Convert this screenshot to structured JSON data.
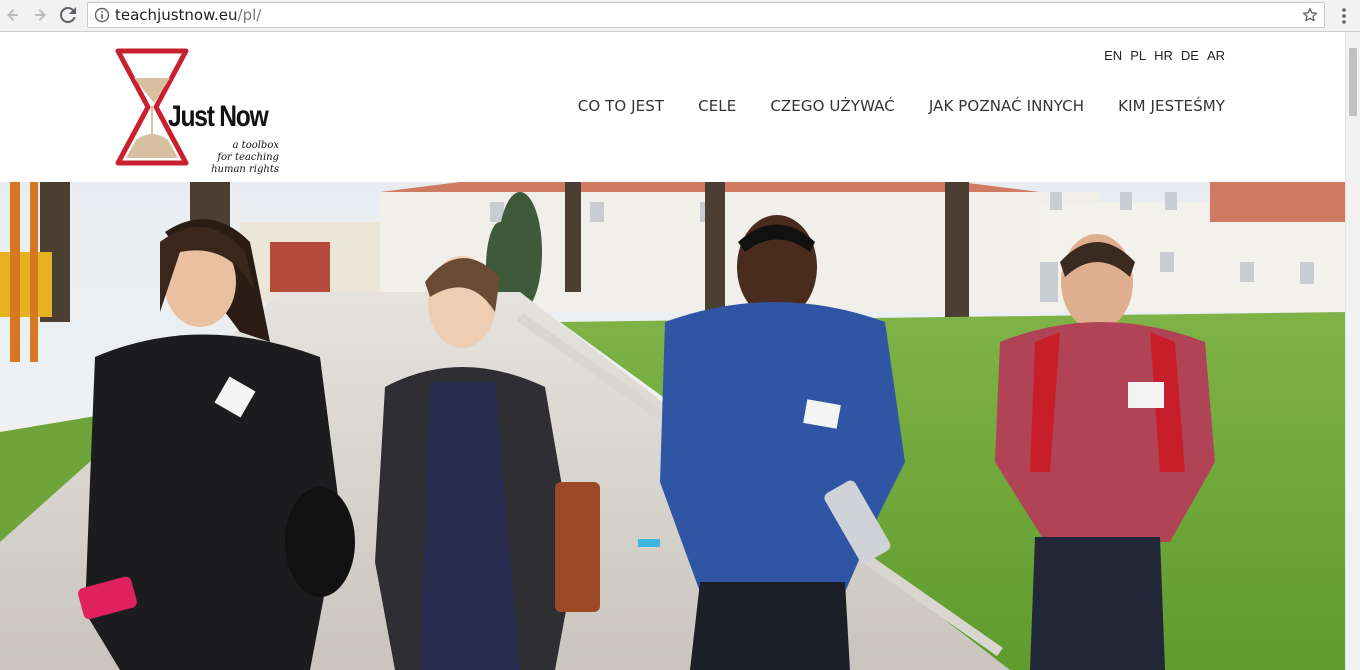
{
  "browser": {
    "url_domain": "teachjustnow.eu",
    "url_path": "/pl/"
  },
  "logo": {
    "brand": "Just Now",
    "tagline": [
      "a toolbox",
      "for teaching",
      "human rights"
    ]
  },
  "languages": [
    "EN",
    "PL",
    "HR",
    "DE",
    "AR"
  ],
  "nav": [
    "CO TO JEST",
    "CELE",
    "CZEGO UŻYWAĆ",
    "JAK POZNAĆ INNYCH",
    "KIM JESTEŚMY"
  ],
  "colors": {
    "logo_red": "#c8202f",
    "logo_sand": "#d8bfa0",
    "nav_text": "#333333"
  },
  "icons": [
    "back-icon",
    "forward-icon",
    "reload-icon",
    "info-icon",
    "star-icon",
    "menu-dots-icon"
  ]
}
